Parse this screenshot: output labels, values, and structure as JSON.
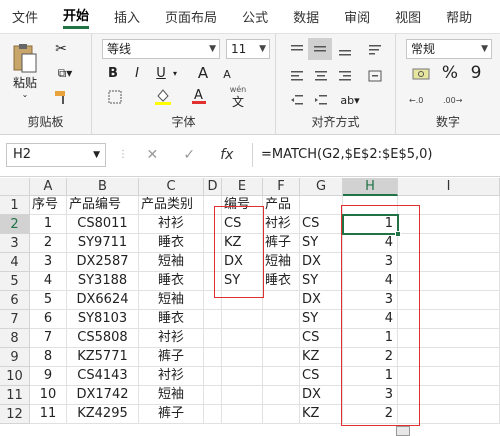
{
  "ribbon_tabs": [
    "文件",
    "开始",
    "插入",
    "页面布局",
    "公式",
    "数据",
    "审阅",
    "视图",
    "帮助"
  ],
  "clipboard": {
    "paste": "粘贴",
    "label": "剪贴板"
  },
  "font": {
    "name": "等线",
    "size": "11",
    "label": "字体",
    "bold": "B",
    "italic": "I",
    "underline": "U",
    "bigA": "A",
    "smallA": "A",
    "wen": "wén",
    "wen_char": "文"
  },
  "alignment": {
    "label": "对齐方式"
  },
  "number": {
    "format": "常规",
    "label": "数字",
    "percent": "%",
    "comma": "9"
  },
  "formula_bar": {
    "name_box": "H2",
    "cancel": "✕",
    "enter": "✓",
    "fx": "fx",
    "formula": "=MATCH(G2,$E$2:$E$5,0)"
  },
  "columns": [
    "A",
    "B",
    "C",
    "D",
    "E",
    "F",
    "G",
    "H",
    "I"
  ],
  "rows": [
    "1",
    "2",
    "3",
    "4",
    "5",
    "6",
    "7",
    "8",
    "9",
    "10",
    "11",
    "12"
  ],
  "table": {
    "headers": {
      "A": "序号",
      "B": "产品编号",
      "C": "产品类别",
      "E": "编号",
      "F": "产品"
    },
    "A": [
      "1",
      "2",
      "3",
      "4",
      "5",
      "6",
      "7",
      "8",
      "9",
      "10",
      "11"
    ],
    "B": [
      "CS8011",
      "SY9711",
      "DX2587",
      "SY3188",
      "DX6624",
      "SY8103",
      "CS5808",
      "KZ5771",
      "CS4143",
      "DX1742",
      "KZ4295"
    ],
    "C": [
      "衬衫",
      "睡衣",
      "短袖",
      "睡衣",
      "短袖",
      "睡衣",
      "衬衫",
      "裤子",
      "衬衫",
      "短袖",
      "裤子"
    ],
    "E": [
      "CS",
      "KZ",
      "DX",
      "SY"
    ],
    "F": [
      "衬衫",
      "裤子",
      "短袖",
      "睡衣"
    ],
    "G": [
      "CS",
      "SY",
      "DX",
      "SY",
      "DX",
      "SY",
      "CS",
      "KZ",
      "CS",
      "DX",
      "KZ"
    ],
    "H": [
      "1",
      "4",
      "3",
      "4",
      "3",
      "4",
      "1",
      "2",
      "1",
      "3",
      "2"
    ]
  }
}
